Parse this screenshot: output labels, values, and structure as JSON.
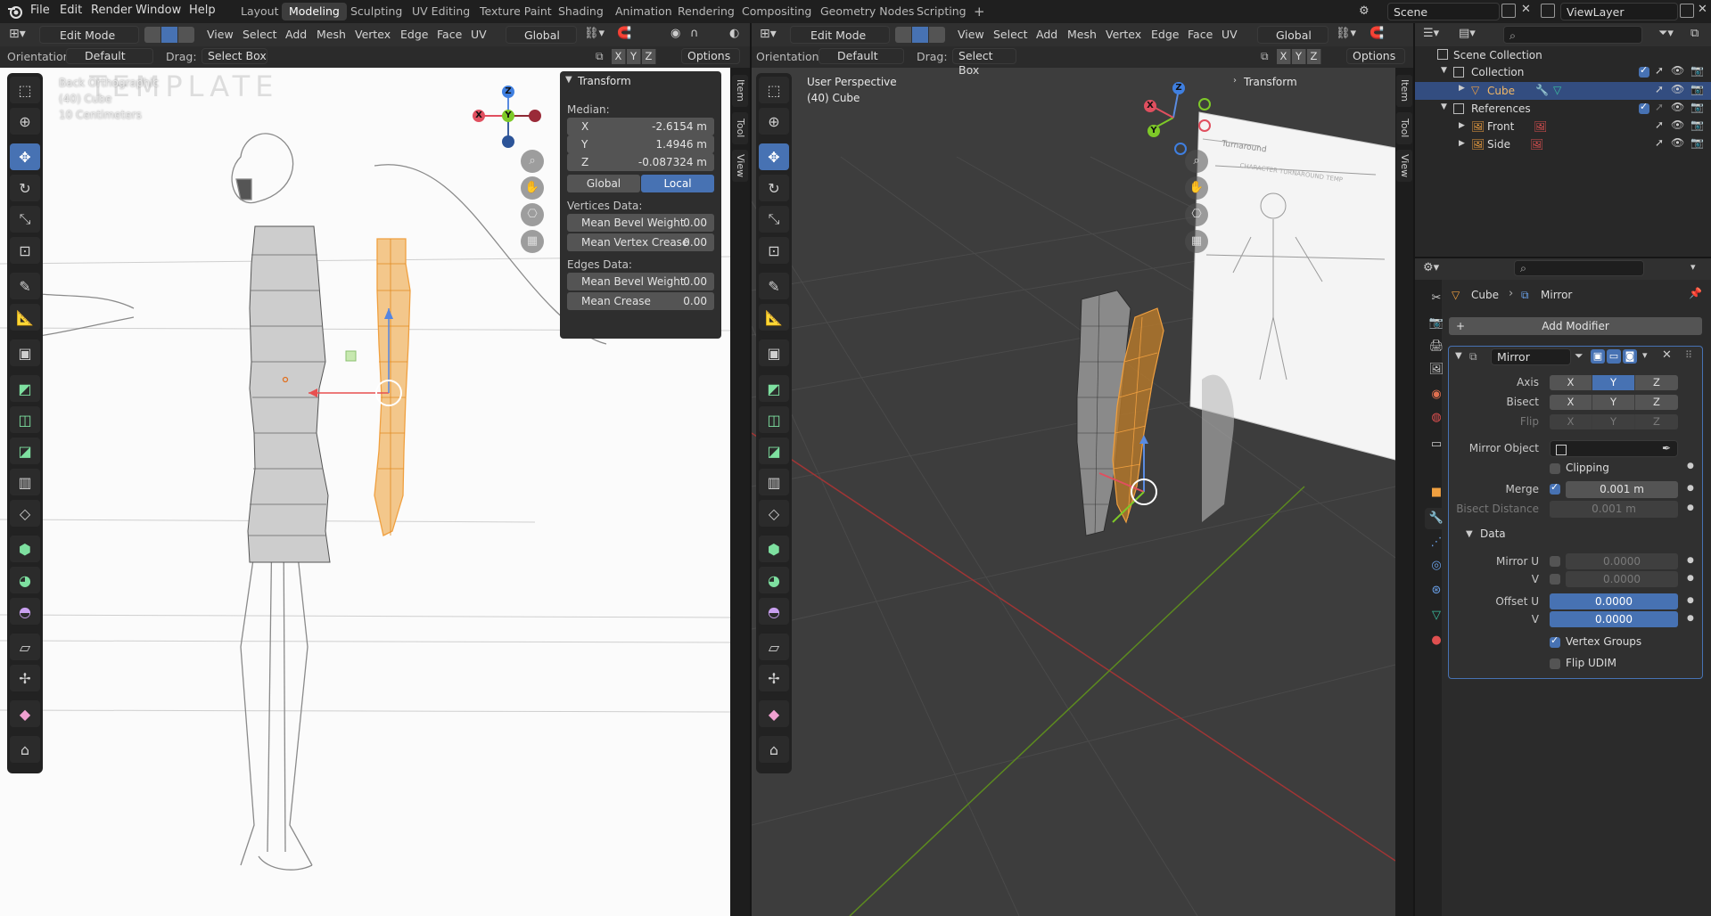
{
  "topbar": {
    "menus": [
      "File",
      "Edit",
      "Render",
      "Window",
      "Help"
    ],
    "workspaces": [
      "Layout",
      "Modeling",
      "Sculpting",
      "UV Editing",
      "Texture Paint",
      "Shading",
      "Animation",
      "Rendering",
      "Compositing",
      "Geometry Nodes",
      "Scripting"
    ],
    "active_workspace": "Modeling",
    "add_tab": "+",
    "scene": "Scene",
    "view_layer": "ViewLayer"
  },
  "left_viewport": {
    "mode": "Edit Mode",
    "menus": [
      "View",
      "Select",
      "Add",
      "Mesh",
      "Vertex",
      "Edge",
      "Face",
      "UV"
    ],
    "transform_orientation": "Global",
    "orientation_label": "Orientation:",
    "orientation_value": "Default",
    "drag_label": "Drag:",
    "drag_value": "Select Box",
    "options": "Options",
    "axis_x": "X",
    "axis_y": "Y",
    "axis_z": "Z",
    "overlay_title": "Back Orthographic",
    "overlay_object": "(40) Cube",
    "overlay_scale": "10 Centimeters",
    "bg_text": "TEMPLATE",
    "sidetabs": [
      "Item",
      "Tool",
      "View"
    ]
  },
  "transform_panel": {
    "title": "Transform",
    "median_label": "Median:",
    "x_label": "X",
    "x_value": "-2.6154 m",
    "y_label": "Y",
    "y_value": "1.4946 m",
    "z_label": "Z",
    "z_value": "-0.087324 m",
    "global": "Global",
    "local": "Local",
    "vertices_data": "Vertices Data:",
    "mean_bevel_weight": "Mean Bevel Weight",
    "mean_bevel_weight_value": "0.00",
    "mean_vertex_crease": "Mean Vertex Crease",
    "mean_vertex_crease_value": "0.00",
    "edges_data": "Edges Data:",
    "edge_bevel_weight": "Mean Bevel Weight",
    "edge_bevel_weight_value": "0.00",
    "mean_crease": "Mean Crease",
    "mean_crease_value": "0.00"
  },
  "right_viewport": {
    "mode": "Edit Mode",
    "menus": [
      "View",
      "Select",
      "Add",
      "Mesh",
      "Vertex",
      "Edge",
      "Face",
      "UV"
    ],
    "transform_orientation": "Global",
    "orientation_label": "Orientation:",
    "orientation_value": "Default",
    "drag_label": "Drag:",
    "drag_value": "Select Box",
    "options": "Options",
    "overlay_title": "User Perspective",
    "overlay_object": "(40) Cube",
    "transform_collapsed": "Transform",
    "sidetabs": [
      "Item",
      "Tool",
      "View"
    ],
    "ref_text1": "Turnaround",
    "ref_text2": "CHARACTER TURNAROUND TEMP"
  },
  "outliner": {
    "scene_collection": "Scene Collection",
    "collection": "Collection",
    "cube": "Cube",
    "references": "References",
    "front": "Front",
    "side": "Side"
  },
  "properties": {
    "breadcrumb_object": "Cube",
    "breadcrumb_modifier": "Mirror",
    "add_modifier": "Add Modifier",
    "modifier_name": "Mirror",
    "axis_label": "Axis",
    "bisect_label": "Bisect",
    "flip_label": "Flip",
    "x": "X",
    "y": "Y",
    "z": "Z",
    "mirror_object_label": "Mirror Object",
    "clipping": "Clipping",
    "merge_label": "Merge",
    "merge_value": "0.001 m",
    "bisect_distance_label": "Bisect Distance",
    "bisect_distance_value": "0.001 m",
    "data_section": "Data",
    "mirror_u_label": "Mirror U",
    "mirror_u_value": "0.0000",
    "v_label": "V",
    "mirror_v_value": "0.0000",
    "offset_u_label": "Offset U",
    "offset_u_value": "0.0000",
    "offset_v_value": "0.0000",
    "vertex_groups": "Vertex Groups",
    "flip_udim": "Flip UDIM"
  },
  "colors": {
    "accent": "#4772b3",
    "selection_orange": "#f0a040",
    "grid_x_axis": "#b03030",
    "grid_y_axis": "#6a9a20"
  }
}
